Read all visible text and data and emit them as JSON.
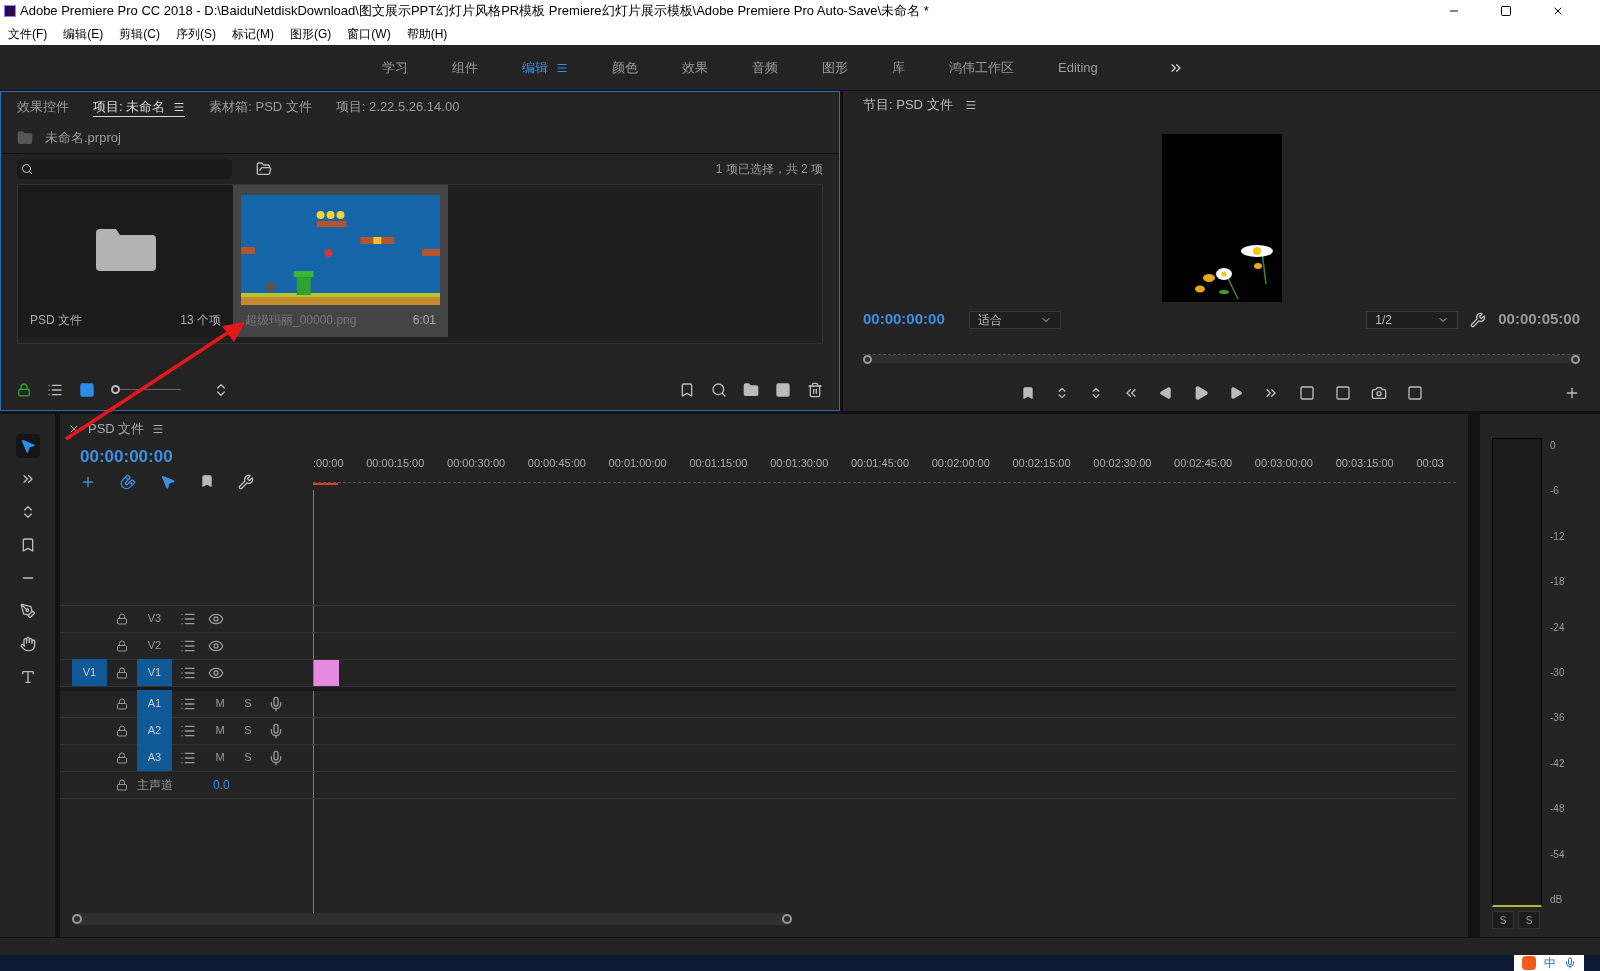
{
  "window": {
    "title": "Adobe Premiere Pro CC 2018 - D:\\BaiduNetdiskDownload\\图文展示PPT幻灯片风格PR模板 Premiere幻灯片展示模板\\Adobe Premiere Pro Auto-Save\\未命名 *"
  },
  "menu": [
    "文件(F)",
    "编辑(E)",
    "剪辑(C)",
    "序列(S)",
    "标记(M)",
    "图形(G)",
    "窗口(W)",
    "帮助(H)"
  ],
  "workspaces": [
    {
      "label": "学习",
      "selected": false
    },
    {
      "label": "组件",
      "selected": false
    },
    {
      "label": "编辑",
      "selected": true
    },
    {
      "label": "颜色",
      "selected": false
    },
    {
      "label": "效果",
      "selected": false
    },
    {
      "label": "音频",
      "selected": false
    },
    {
      "label": "图形",
      "selected": false
    },
    {
      "label": "库",
      "selected": false
    },
    {
      "label": "鸿伟工作区",
      "selected": false
    },
    {
      "label": "Editing",
      "selected": false
    }
  ],
  "project_panel": {
    "tabs": [
      {
        "label": "效果控件",
        "selected": false
      },
      {
        "label": "项目: 未命名",
        "selected": true
      },
      {
        "label": "素材箱: PSD 文件",
        "selected": false
      },
      {
        "label": "项目: 2.22.5.26.14.00",
        "selected": false
      }
    ],
    "project_file": "未命名.prproj",
    "zoom_slider": {
      "level": 0
    },
    "selection_info": "1 项已选择，共 2 项",
    "items": [
      {
        "kind": "folder",
        "name": "PSD 文件",
        "info": "13 个项",
        "selected": false
      },
      {
        "name": "超级玛丽_00000.png",
        "info": "6:01",
        "selected": true
      }
    ]
  },
  "program_monitor": {
    "title": "节目: PSD 文件",
    "timecode": "00:00:00:00",
    "fit": "适合",
    "resolution": "1/2",
    "duration": "00:00:05:00"
  },
  "timeline": {
    "title": "PSD 文件",
    "timecode": "00:00:00:00",
    "ruler": [
      ":00:00",
      "00:00:15:00",
      "00:00:30:00",
      "00:00:45:00",
      "00:01:00:00",
      "00:01:15:00",
      "00:01:30:00",
      "00:01:45:00",
      "00:02:00:00",
      "00:02:15:00",
      "00:02:30:00",
      "00:02:45:00",
      "00:03:00:00",
      "00:03:15:00",
      "00:03"
    ],
    "tracks": [
      {
        "kind": "video",
        "label": "V3",
        "targeted": false
      },
      {
        "kind": "video",
        "label": "V2",
        "targeted": false
      },
      {
        "kind": "video",
        "label": "V1",
        "targeted": true,
        "source": "V1",
        "has_clip": true
      },
      {
        "kind": "audio",
        "label": "A1",
        "targeted": true,
        "mute": "M",
        "solo": "S"
      },
      {
        "kind": "audio",
        "label": "A2",
        "targeted": true,
        "mute": "M",
        "solo": "S"
      },
      {
        "kind": "audio",
        "label": "A3",
        "targeted": true,
        "mute": "M",
        "solo": "S"
      }
    ],
    "master": {
      "label": "主声道",
      "value": "0.0"
    }
  },
  "audio_meter": {
    "scale": [
      "0",
      "-6",
      "-12",
      "-18",
      "-24",
      "-30",
      "-36",
      "-42",
      "-48",
      "-54",
      "dB"
    ],
    "solo_buttons": [
      "S",
      "S"
    ]
  },
  "ime_bar": {
    "label": "中"
  }
}
